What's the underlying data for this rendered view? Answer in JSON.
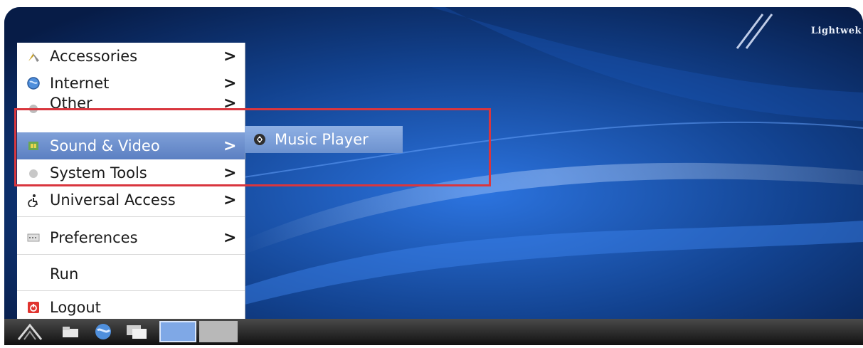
{
  "desktop": {
    "brand": "Lightwek",
    "colors": {
      "wallpaper_dark": "#0b2a63",
      "wallpaper_light": "#1f5fc4",
      "highlight_box": "#d9363e"
    }
  },
  "menu": {
    "items": [
      {
        "label": "Accessories",
        "icon": "accessories-icon",
        "has_submenu": true
      },
      {
        "label": "Internet",
        "icon": "internet-globe-icon",
        "has_submenu": true
      },
      {
        "label": "Other",
        "icon": "other-bullet-icon",
        "has_submenu": true
      },
      {
        "label": "Sound & Video",
        "icon": "sound-video-icon",
        "has_submenu": true,
        "selected": true
      },
      {
        "label": "System Tools",
        "icon": "system-tools-icon",
        "has_submenu": true
      },
      {
        "label": "Universal Access",
        "icon": "universal-access-icon",
        "has_submenu": true
      },
      {
        "label": "Preferences",
        "icon": "preferences-icon",
        "has_submenu": true
      },
      {
        "label": "Run",
        "icon": "",
        "has_submenu": false
      },
      {
        "label": "Logout",
        "icon": "logout-icon",
        "has_submenu": false
      }
    ],
    "arrow": ">"
  },
  "submenu": {
    "items": [
      {
        "label": "Music Player",
        "icon": "music-player-icon"
      }
    ]
  },
  "taskbar": {
    "items": [
      "start-menu-icon",
      "file-manager-icon",
      "browser-icon",
      "show-desktop-icon",
      "workspace-1",
      "workspace-2"
    ]
  }
}
